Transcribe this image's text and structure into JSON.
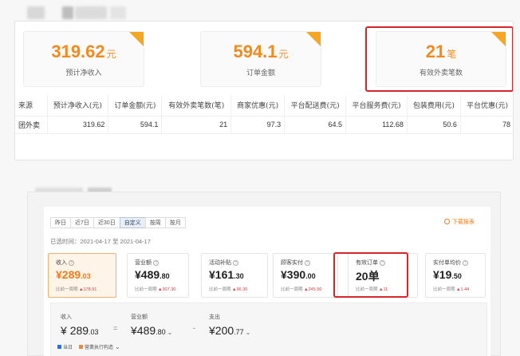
{
  "summary_cards": [
    {
      "value": "319.62",
      "unit": "元",
      "label": "预计净收入"
    },
    {
      "value": "594.1",
      "unit": "元",
      "label": "订单金额"
    },
    {
      "value": "21",
      "unit": "笔",
      "label": "有效外卖笔数"
    }
  ],
  "table": {
    "headers": [
      "来源",
      "预计净收入(元)",
      "订单金额(元)",
      "有效外卖笔数(笔)",
      "商家优惠(元)",
      "平台配送费(元)",
      "平台服务费(元)",
      "包装费用(元)",
      "平台优惠(元)"
    ],
    "rows": [
      [
        "团外卖",
        "319.62",
        "594.1",
        "21",
        "97.3",
        "64.5",
        "112.68",
        "50.6",
        "78"
      ]
    ]
  },
  "dashboard": {
    "tabs": [
      "昨日",
      "近7日",
      "近30日",
      "自定义",
      "按周",
      "按月"
    ],
    "active_tab": "自定义",
    "download_label": "下载报表",
    "stat_time": "已选时间：2021-04-17 至 2021-04-17",
    "metrics": [
      {
        "title": "收入",
        "value": "¥289",
        "decimal": ".03",
        "compare_text": "比前一周期",
        "compare_value": "178.91"
      },
      {
        "title": "营业额",
        "value": "¥489",
        "decimal": ".80",
        "compare_text": "比前一周期",
        "compare_value": "307.30"
      },
      {
        "title": "活动补贴",
        "value": "¥161",
        "decimal": ".30",
        "compare_text": "比前一周期",
        "compare_value": "96.30"
      },
      {
        "title": "顾客实付",
        "value": "¥390",
        "decimal": ".00",
        "compare_text": "比前一周期",
        "compare_value": "245.50"
      },
      {
        "title": "有效订单",
        "value": "20单",
        "decimal": "",
        "compare_text": "比前一周期",
        "compare_value": "11"
      },
      {
        "title": "实付单均价",
        "value": "¥19",
        "decimal": ".50",
        "compare_text": "比前一周期",
        "compare_value": "1.44"
      }
    ],
    "formula": {
      "income_label": "收入",
      "income_value": "289",
      "income_decimal": ".03",
      "op_equals": "=",
      "turnover_label": "营业额",
      "turnover_value": "¥489",
      "turnover_decimal": ".80",
      "op_minus": "-",
      "expense_label": "支出",
      "expense_value": "¥200",
      "expense_decimal": ".77",
      "legend_today": "当日",
      "legend_composition": "营業执行构造"
    }
  },
  "colors": {
    "accent": "#f28a1e",
    "highlight": "#d6262a",
    "blue": "#2f6fd6"
  }
}
